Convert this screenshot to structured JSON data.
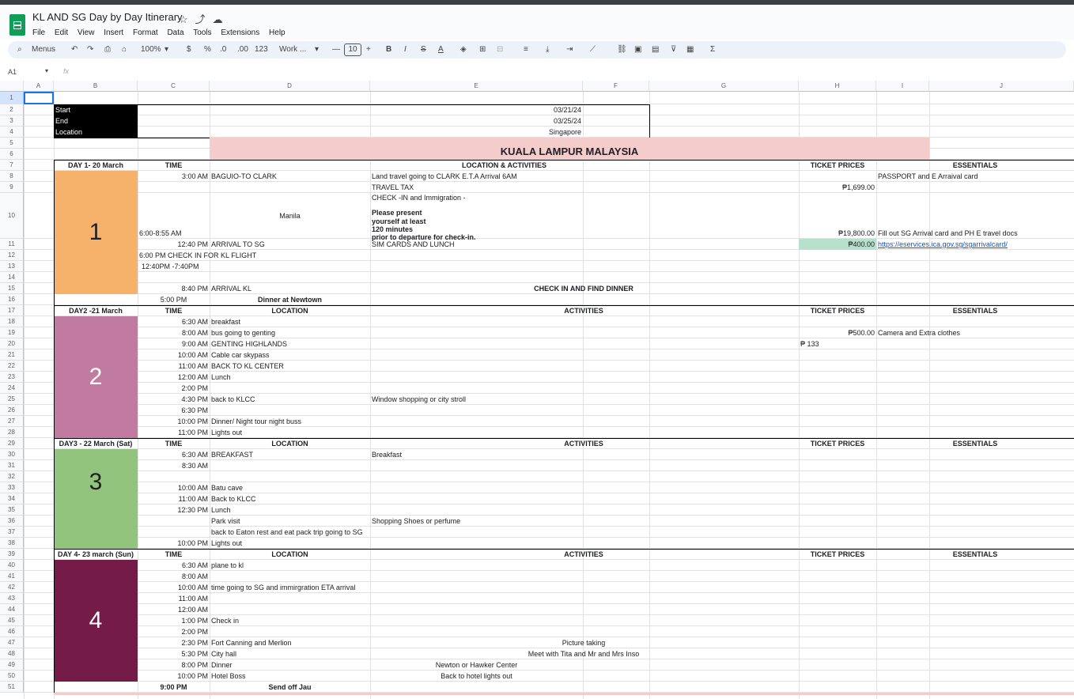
{
  "app": {
    "doc_title": "KL AND SG Day by Day Itinerary",
    "menus": [
      "File",
      "Edit",
      "View",
      "Insert",
      "Format",
      "Data",
      "Tools",
      "Extensions",
      "Help"
    ]
  },
  "toolbar": {
    "search_label": "Menus",
    "zoom": "100%",
    "currency": "$",
    "percent": "%",
    "dec_decrease": ".0",
    "dec_increase": ".00",
    "number_format": "123",
    "font": "Work ...",
    "font_size": "10",
    "minus": "—",
    "plus": "+",
    "bold": "B",
    "italic": "I",
    "strike": "S",
    "text_color": "A",
    "sigma": "Σ"
  },
  "formula_bar": {
    "name_box": "A1",
    "fx": "fx"
  },
  "columns": [
    "A",
    "B",
    "C",
    "D",
    "E",
    "F",
    "G",
    "H",
    "I",
    "J"
  ],
  "rows": [
    "1",
    "2",
    "3",
    "4",
    "5",
    "6",
    "7",
    "8",
    "9",
    "10",
    "11",
    "12",
    "13",
    "14",
    "15",
    "16",
    "17",
    "18",
    "19",
    "20",
    "21",
    "22",
    "23",
    "24",
    "25",
    "26",
    "27",
    "28",
    "29",
    "30",
    "31",
    "32",
    "33",
    "34",
    "35",
    "36",
    "37",
    "38",
    "39",
    "40",
    "41",
    "42",
    "43",
    "44",
    "45",
    "46",
    "47",
    "48",
    "49",
    "50",
    "51"
  ],
  "info": {
    "start_label": "Start",
    "start_value": "03/21/24",
    "end_label": "End",
    "end_value": "03/25/24",
    "location_label": "Location",
    "location_value": "Singapore"
  },
  "banner": "KUALA LAMPUR MALAYSIA",
  "day1": {
    "header": "DAY 1- 20 March",
    "time_h": "TIME",
    "loc_h": "LOCATION & ACTIVITIES",
    "ticket_h": "TICKET PRICES",
    "ess_h": "ESSENTIALS",
    "number": "1",
    "r8_time": "3:00 AM",
    "r8_loc": "BAGUIO-TO CLARK",
    "r8_act": "Land travel going to CLARK E.T.A Arrival 6AM",
    "r8_ess": "PASSPORT  and E Arraival card",
    "r9_act": "TRAVEL TAX",
    "r9_price": "₱1,699.00",
    "r10_time": "6:00-8:55 AM",
    "r10_loc": "Manila",
    "r10_act1": "CHECK -IN and Immigration -",
    "r10_act2": "Please present",
    "r10_act3": "yourself at least",
    "r10_act4": "120 minutes",
    "r10_act5": "prior to departure for check-in.",
    "r10_price": "₱19,800.00",
    "r10_ess": "Fill out SG Arrival card and PH E travel docs",
    "r11_time": "12:40 PM",
    "r11_loc": "ARRIVAL TO SG",
    "r11_act": "SIM CARDS AND LUNCH",
    "r11_price": "₱400.00",
    "r11_link": "https://eservices.ica.gov.sg/sgarrivalcard/",
    "r12": "6:00 PM CHECK IN FOR KL FLIGHT",
    "r13": "12:40PM -7:40PM",
    "r15_time": "8:40 PM",
    "r15_loc": "ARRIVAL  KL",
    "r15_act": "CHECK IN AND FIND DINNER",
    "r16_time": "5:00 PM",
    "r16_loc": "Dinner at Newtown"
  },
  "day2": {
    "header": "DAY2 -21 March",
    "time_h": "TIME",
    "loc_h": "LOCATION",
    "act_h": "ACTIVITIES",
    "ticket_h": "TICKET PRICES",
    "ess_h": "ESSENTIALS",
    "number": "2",
    "items": [
      {
        "time": "6:30 AM",
        "loc": "breakfast"
      },
      {
        "time": "8:00 AM",
        "loc": "bus going to genting"
      },
      {
        "time": "9:00 AM",
        "loc": "GENTING HIGHLANDS"
      },
      {
        "time": "10:00 AM",
        "loc": "Cable car skypass"
      },
      {
        "time": "11:00 AM",
        "loc": "BACK TO KL CENTER"
      },
      {
        "time": "12:00 AM",
        "loc": "Lunch"
      },
      {
        "time": "2:00 PM",
        "loc": ""
      },
      {
        "time": "4:30 PM",
        "loc": "back to KLCC"
      },
      {
        "time": "6:30 PM",
        "loc": ""
      },
      {
        "time": "10:00 PM",
        "loc": "Dinner/ Night tour night buss"
      },
      {
        "time": "11:00 PM",
        "loc": "Lights out"
      }
    ],
    "r19_price": "₱500.00",
    "r19_ess": "Camera and Extra clothes",
    "r20_price": "₱ 133",
    "r25_act": "Window shopping or city stroll"
  },
  "day3": {
    "header": "DAY3 - 22 March (Sat)",
    "time_h": "TIME",
    "loc_h": "LOCATION",
    "act_h": "ACTIVITIES",
    "ticket_h": "TICKET PRICES",
    "ess_h": "ESSENTIALS",
    "number": "3",
    "r30_time": "6:30 AM",
    "r30_loc": "BREAKFAST",
    "r30_act": "Breakfast",
    "r31_time": "8:30 AM",
    "r33_time": "10:00 AM",
    "r33_loc": "Batu cave",
    "r34_time": "11:00 AM",
    "r34_loc": "Back to KLCC",
    "r35_time": "12:30 PM",
    "r35_loc": "Lunch",
    "r36_loc": "Park visit",
    "r36_act": "Shopping Shoes or perfume",
    "r37_loc": "back to Eaton rest and eat pack  trip going to SG",
    "r38_time": "10:00 PM",
    "r38_loc": "Lights out"
  },
  "day4": {
    "header": "DAY 4- 23 march (Sun)",
    "time_h": "TIME",
    "loc_h": "LOCATION",
    "act_h": "ACTIVITIES",
    "ticket_h": "TICKET PRICES",
    "ess_h": "ESSENTIALS",
    "number": "4",
    "times": [
      "6:30 AM",
      "8:00 AM",
      "10:00 AM",
      "11:00 AM",
      "12:00 AM",
      "1:00 PM",
      "2:00 PM",
      "2:30 PM",
      "5:30 PM",
      "8:00 PM",
      "10:00 PM"
    ],
    "r40_loc": "plane to kl",
    "r42_loc": "time going to SG and immirgration ETA arrival",
    "r45_loc": "Check in",
    "r47_loc": "Fort Canning and Merlion",
    "r47_act": "Picture taking",
    "r48_loc": "City hall",
    "r48_act": "Meet with Tita and Mr and Mrs Inso",
    "r49_loc": "Dinner",
    "r49_act": "Newton or Hawker Center",
    "r50_loc": "Hotel Boss",
    "r50_act": "Back to hotel lights out",
    "r51_time": "9:00 PM",
    "r51_loc": "Send off Jau"
  },
  "colors": {
    "day1": "#f6b26b",
    "day2": "#c27ba0",
    "day3": "#93c47d",
    "day4": "#741b47",
    "banner": "#f4cccc",
    "price_highlight": "#b7e1cd",
    "info_label_bg": "#000000"
  }
}
